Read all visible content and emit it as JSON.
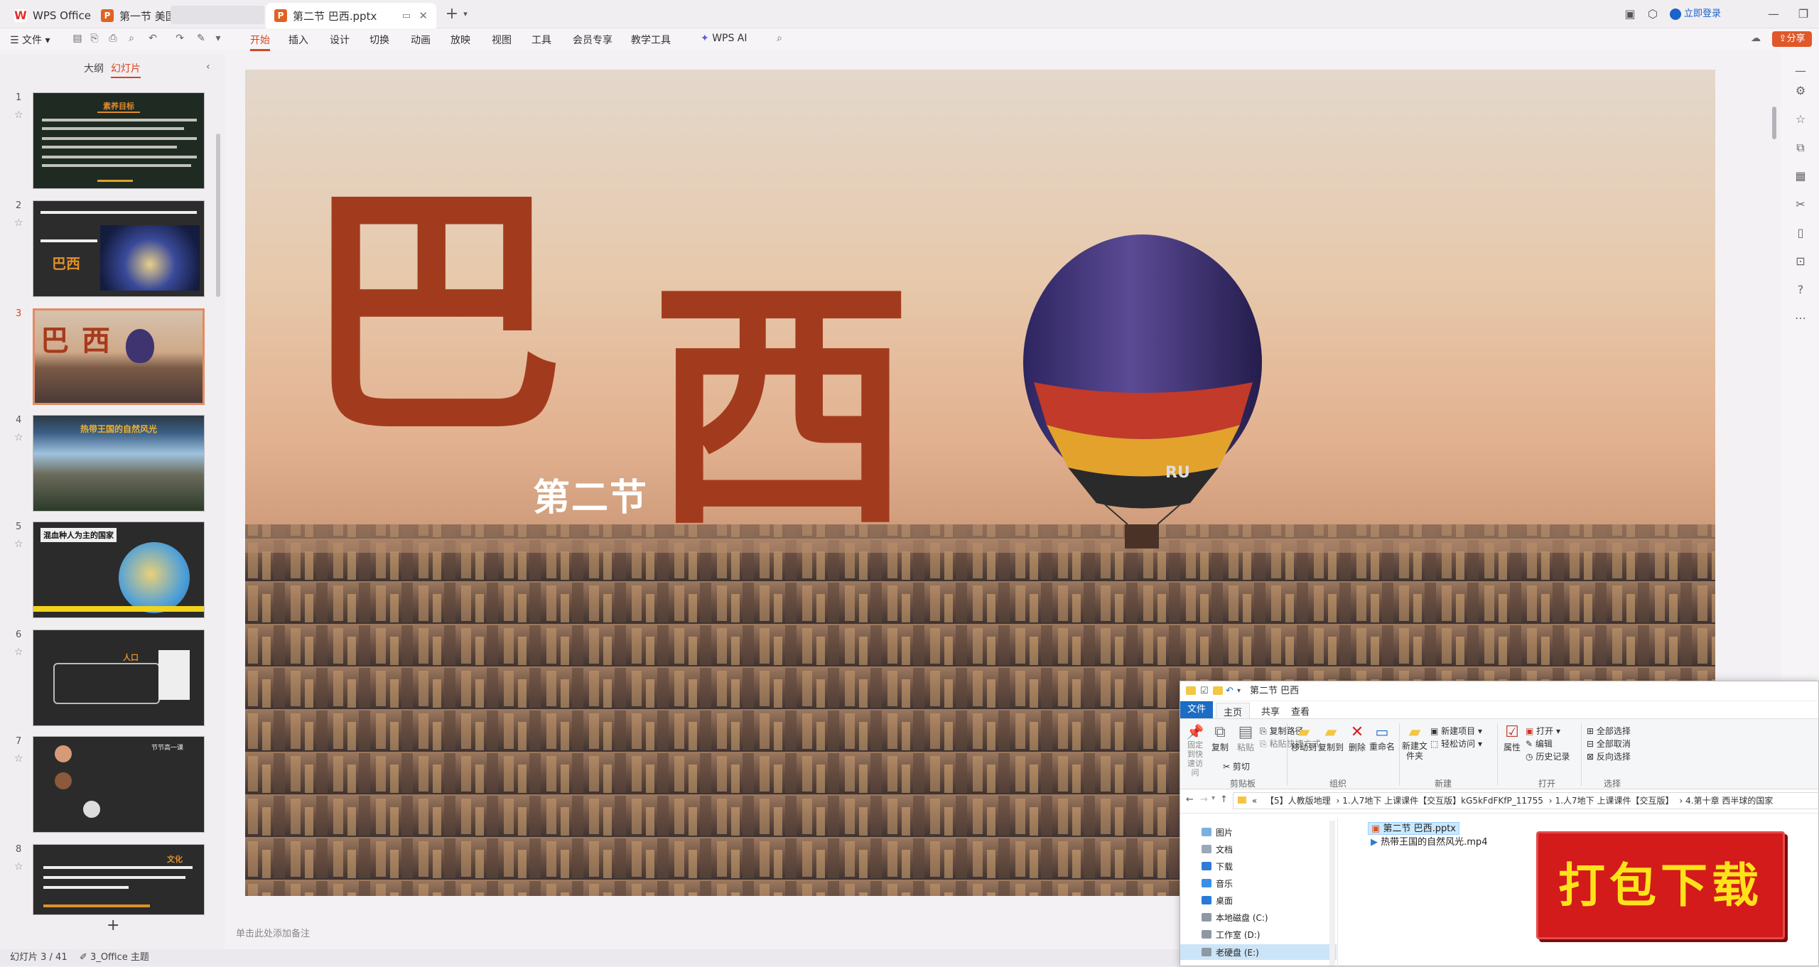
{
  "titlebar": {
    "tabs": [
      {
        "label": "WPS Office",
        "icon": "wps-logo-icon"
      },
      {
        "label": "第一节 美国.pptx",
        "icon": "ppt-file-icon"
      },
      {
        "label": "第二节 巴西.pptx",
        "icon": "ppt-file-icon"
      }
    ],
    "new_tab": "+",
    "login": "立即登录",
    "share": "分享"
  },
  "menubar": {
    "file": "文件",
    "items": [
      "开始",
      "插入",
      "设计",
      "切换",
      "动画",
      "放映",
      "视图",
      "工具",
      "会员专享",
      "教学工具",
      "WPS AI"
    ],
    "active": "开始"
  },
  "leftpanel": {
    "tabs": [
      "大纲",
      "幻灯片"
    ],
    "active_tab": "幻灯片",
    "thumbs": [
      {
        "num": "1",
        "title": "素养目标"
      },
      {
        "num": "2",
        "title": "巴西"
      },
      {
        "num": "3",
        "title": "巴西"
      },
      {
        "num": "4",
        "title": "热带王国的自然风光"
      },
      {
        "num": "5",
        "title": "混血种人为主的国家"
      },
      {
        "num": "6",
        "title": "人口"
      },
      {
        "num": "7",
        "title": "节节高一课"
      },
      {
        "num": "8",
        "title": "文化"
      }
    ],
    "add": "+"
  },
  "slide": {
    "title_char1": "巴",
    "title_char2": "西",
    "subtitle": "第二节",
    "balloon_text": "RU"
  },
  "notes_placeholder": "单击此处添加备注",
  "statusbar": {
    "slide_info": "幻灯片 3 / 41",
    "theme": "3_Office 主题"
  },
  "explorer": {
    "title": "第二节 巴西",
    "ribbon_tabs": [
      "文件",
      "主页",
      "共享",
      "查看"
    ],
    "clipboard": {
      "pin": "固定到快速访问",
      "copy": "复制",
      "paste": "粘贴",
      "copy_path": "复制路径",
      "paste_shortcut": "粘贴快捷方式",
      "cut": "剪切",
      "group": "剪贴板"
    },
    "organize": {
      "move": "移动到",
      "copyto": "复制到",
      "delete": "删除",
      "rename": "重命名",
      "group": "组织"
    },
    "new": {
      "folder": "新建文件夹",
      "item": "新建项目",
      "easy": "轻松访问",
      "group": "新建"
    },
    "open": {
      "props": "属性",
      "open": "打开",
      "edit": "编辑",
      "history": "历史记录",
      "group": "打开"
    },
    "select": {
      "all": "全部选择",
      "none": "全部取消",
      "invert": "反向选择",
      "group": "选择"
    },
    "breadcrumb": [
      "«",
      "【5】人教版地理",
      "1.人7地下 上课课件【交互版】kG5kFdFKfP_11755",
      "1.人7地下 上课课件【交互版】",
      "4.第十章 西半球的国家"
    ],
    "nav": [
      "图片",
      "文档",
      "下载",
      "音乐",
      "桌面",
      "本地磁盘 (C:)",
      "工作室 (D:)",
      "老硬盘 (E:)"
    ],
    "files": [
      "第二节 巴西.pptx",
      "热带王国的自然风光.mp4"
    ]
  },
  "promo": {
    "text": "打包下载"
  }
}
